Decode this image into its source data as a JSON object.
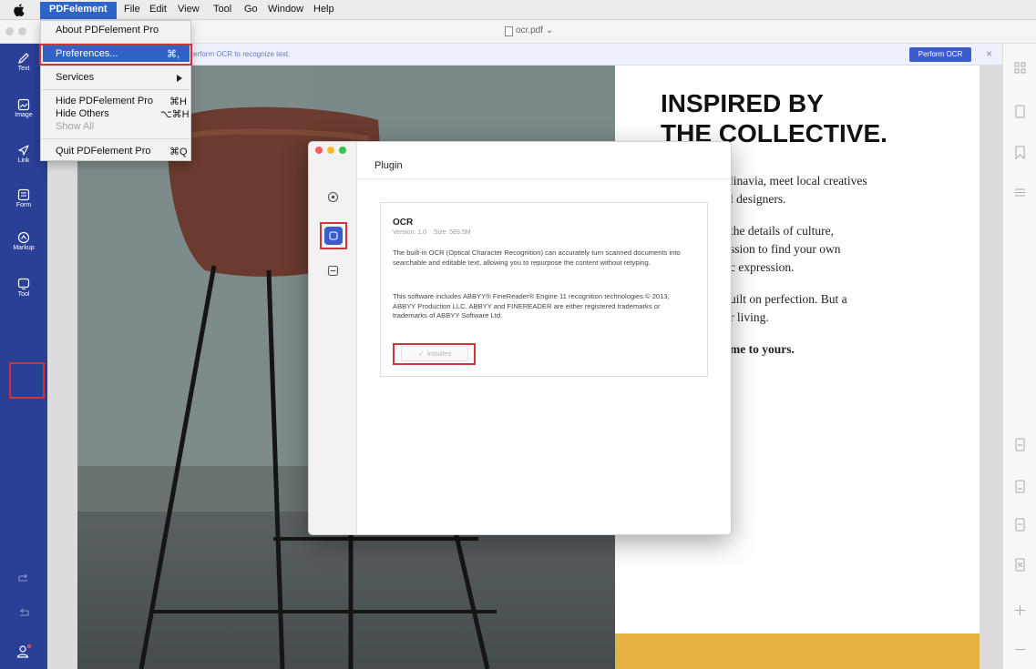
{
  "menubar": {
    "apple_icon": "apple-icon",
    "app_name": "PDFelement",
    "items": [
      "File",
      "Edit",
      "View",
      "Tool",
      "Go",
      "Window",
      "Help"
    ]
  },
  "app_menu": {
    "about": "About PDFelement Pro",
    "preferences": "Preferences...",
    "preferences_shortcut": "⌘,",
    "services": "Services",
    "hide": "Hide PDFelement Pro",
    "hide_shortcut": "⌘H",
    "hide_others": "Hide Others",
    "hide_others_shortcut": "⌥⌘H",
    "show_all": "Show All",
    "quit": "Quit PDFelement Pro",
    "quit_shortcut": "⌘Q"
  },
  "window": {
    "document_title": "ocr.pdf ⌄"
  },
  "left_toolbar": {
    "items": [
      {
        "label": "Text",
        "icon": "pencil-icon"
      },
      {
        "label": "Image",
        "icon": "image-icon"
      },
      {
        "label": "Link",
        "icon": "link-icon"
      },
      {
        "label": "Form",
        "icon": "form-icon"
      },
      {
        "label": "Markup",
        "icon": "markup-icon"
      },
      {
        "label": "Tool",
        "icon": "tool-icon"
      }
    ]
  },
  "ocr_bar": {
    "message": "erform OCR to recognize text.",
    "button": "Perform OCR",
    "close": "×"
  },
  "document": {
    "headline_line1": "INSPIRED BY",
    "headline_line2": "THE COLLECTIVE.",
    "para1_line1": "linavia, meet local creatives",
    "para1_line2": "l designers.",
    "para2_line1": "the details of culture,",
    "para2_line2": "ssion to find your own",
    "para2_line3": "c expression.",
    "para3_line1": "uilt on perfection. But a",
    "para3_line2": "r living.",
    "para4": "me to yours."
  },
  "dialog": {
    "title": "Plugin",
    "plugin": {
      "name": "OCR",
      "meta": "Version: 1.0    Size: 589.5M",
      "desc1": "The built-in OCR (Optical Character Recognition) can accurately turn scanned documents into searchable and editable text, allowing you to repurpose the content without retyping.",
      "desc2": "This software includes ABBYY® FineReader® Engine 11 recognition technologies © 2013, ABBYY Production LLC. ABBYY and FINEREADER are either registered trademarks or trademarks of ABBYY Software Ltd.",
      "status": "✓  Installed"
    }
  },
  "colors": {
    "toolbar_blue": "#2a3f96",
    "menu_highlight": "#2e63c7",
    "annotation_red": "#d0343a",
    "accent_yellow": "#e9b043"
  }
}
